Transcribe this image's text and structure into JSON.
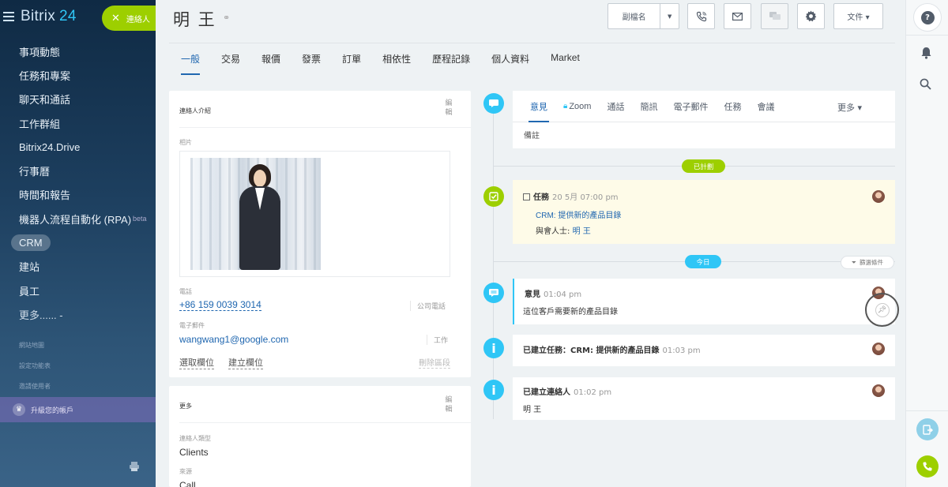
{
  "sidebar": {
    "logo_prefix": "Bitrix",
    "logo_suffix": "24",
    "contact_button": "連絡人",
    "items": [
      {
        "label": "事項動態"
      },
      {
        "label": "任務和專案"
      },
      {
        "label": "聊天和通話"
      },
      {
        "label": "工作群組"
      },
      {
        "label": "Bitrix24.Drive"
      },
      {
        "label": "行事曆"
      },
      {
        "label": "時間和報告"
      },
      {
        "label": "機器人流程自動化 (RPA)",
        "sup": "beta"
      },
      {
        "label": "CRM"
      },
      {
        "label": "建站"
      },
      {
        "label": "員工"
      },
      {
        "label": "更多...... -"
      }
    ],
    "sub_links": [
      "網站地圖",
      "設定功能表",
      "邀請使用者"
    ],
    "upgrade": "升級您的帳戶"
  },
  "header": {
    "title": "明 王",
    "sub_button": "副檔名",
    "doc_button": "文件 ▾"
  },
  "tabs": [
    "一般",
    "交易",
    "報價",
    "發票",
    "訂單",
    "相依性",
    "歷程記錄",
    "個人資料",
    "Market"
  ],
  "contact_card": {
    "title": "連絡人介紹",
    "edit": "編輯",
    "photo_label": "相片",
    "phone_label": "電話",
    "phone_value": "+86 159 0039 3014",
    "phone_tag": "公司電話",
    "email_label": "電子郵件",
    "email_value": "wangwang1@google.com",
    "email_tag": "工作",
    "select_field": "選取欄位",
    "create_field": "建立欄位",
    "delete_section": "刪除區段"
  },
  "more_card": {
    "title": "更多",
    "edit": "編輯",
    "type_label": "連絡人類型",
    "type_value": "Clients",
    "source_label": "來源",
    "source_value": "Call"
  },
  "editor": {
    "tabs": [
      "意見",
      "Zoom",
      "通話",
      "簡訊",
      "電子郵件",
      "任務",
      "會議"
    ],
    "more": "更多 ▾",
    "placeholder": "備註"
  },
  "timeline": {
    "planned": "已計劃",
    "today": "今日",
    "filter": "篩選條件",
    "task": {
      "type": "任務",
      "time": "20 5月 07:00 pm",
      "link": "CRM: 提供新的產品目錄",
      "participants_label": "與會人士:",
      "participant": "明 王"
    },
    "comment": {
      "type": "意見",
      "time": "01:04 pm",
      "text": "這位客戶需要新的產品目錄"
    },
    "created_task": {
      "text": "已建立任務：CRM: 提供新的產品目錄",
      "time": "01:03 pm"
    },
    "created_contact": {
      "text": "已建立連絡人",
      "time": "01:02 pm",
      "name": "明 王"
    }
  },
  "colors": {
    "accent": "#2067b0",
    "green": "#9dcf00",
    "cyan": "#2fc6f6"
  }
}
